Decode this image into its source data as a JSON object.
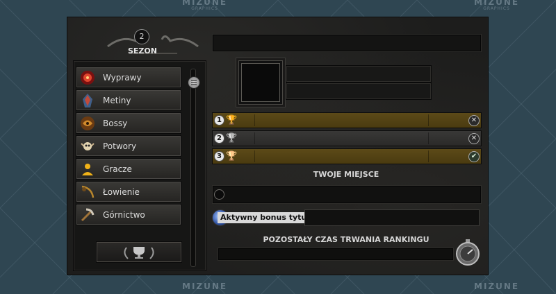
{
  "watermark": {
    "brand": "MIZUNE",
    "sub": "GRAPHICS"
  },
  "season": {
    "number": "2",
    "label": "SEZON"
  },
  "menu": [
    {
      "id": "wyprawy",
      "label": "Wyprawy",
      "icon": "expedition-icon"
    },
    {
      "id": "metiny",
      "label": "Metiny",
      "icon": "metin-stone-icon"
    },
    {
      "id": "bossy",
      "label": "Bossy",
      "icon": "boss-dragon-icon"
    },
    {
      "id": "potwory",
      "label": "Potwory",
      "icon": "monster-skull-icon"
    },
    {
      "id": "gracze",
      "label": "Gracze",
      "icon": "player-icon"
    },
    {
      "id": "lowienie",
      "label": "Łowienie",
      "icon": "fishing-rod-icon"
    },
    {
      "id": "gornictwo",
      "label": "Górnictwo",
      "icon": "pickaxe-icon"
    }
  ],
  "ranking": [
    {
      "place": "1",
      "style": "gold",
      "status": "close"
    },
    {
      "place": "2",
      "style": "gray",
      "status": "close"
    },
    {
      "place": "3",
      "style": "gold",
      "status": "check"
    }
  ],
  "your_place_heading": "TWOJE MIEJSCE",
  "bonus": {
    "label": "Aktywny bonus tytułu:",
    "value": ""
  },
  "remaining_heading": "POZOSTAŁY CZAS TRWANIA RANKINGU",
  "colors": {
    "gold_row": "#5c4a18",
    "gray_row": "#393837",
    "background": "#2f4652"
  }
}
